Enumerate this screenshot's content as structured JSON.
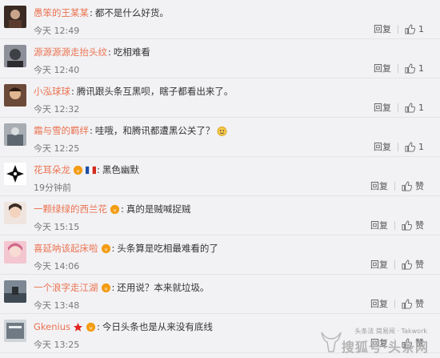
{
  "comments": [
    {
      "user": "愚笨的王某某",
      "text": "都不是什么好货。",
      "time": "今天 12:49",
      "reply": "回复",
      "like": "1",
      "badges": []
    },
    {
      "user": "源源源源走抬头纹",
      "text": "吃相难看",
      "time": "今天 12:40",
      "reply": "回复",
      "like": "1",
      "badges": []
    },
    {
      "user": "小泓球球",
      "text": "腾讯跟头条互黑呗，瞎子都看出来了。",
      "time": "今天 12:32",
      "reply": "回复",
      "like": "1",
      "badges": []
    },
    {
      "user": "霜与雪的羁绊",
      "text": "哇哦，和腾讯都遭黑公关了？",
      "time": "今天 12:25",
      "reply": "回复",
      "like": "1",
      "badges": [
        "emoji"
      ]
    },
    {
      "user": "花耳朵龙",
      "text": "黑色幽默",
      "time": "19分钟前",
      "reply": "回复",
      "like": "赞",
      "badges": [
        "vip",
        "flag"
      ]
    },
    {
      "user": "一颗绿绿的西兰花",
      "text": "真的是贼喊捉贼",
      "time": "今天 15:15",
      "reply": "回复",
      "like": "赞",
      "badges": [
        "vip"
      ]
    },
    {
      "user": "喜延呐该起床啦",
      "text": "头条算是吃相最难看的了",
      "time": "今天 14:06",
      "reply": "回复",
      "like": "赞",
      "badges": [
        "vip"
      ]
    },
    {
      "user": "一个浪字走江湖",
      "text": "还用说？本来就垃圾。",
      "time": "今天 13:48",
      "reply": "回复",
      "like": "赞",
      "badges": [
        "vip"
      ]
    },
    {
      "user": "Gkenius",
      "text": "今日头条也是从来没有底线",
      "time": "今天 13:25",
      "reply": "回复",
      "like": "赞",
      "badges": [
        "star",
        "vip"
      ]
    }
  ],
  "watermark": {
    "small": "头条法 简易阅 · Takwork",
    "big": "搜狐号·头条网"
  },
  "colors": {
    "username": "#eb7350",
    "text": "#333333",
    "time": "#777777",
    "background": "#f2f2f5"
  }
}
